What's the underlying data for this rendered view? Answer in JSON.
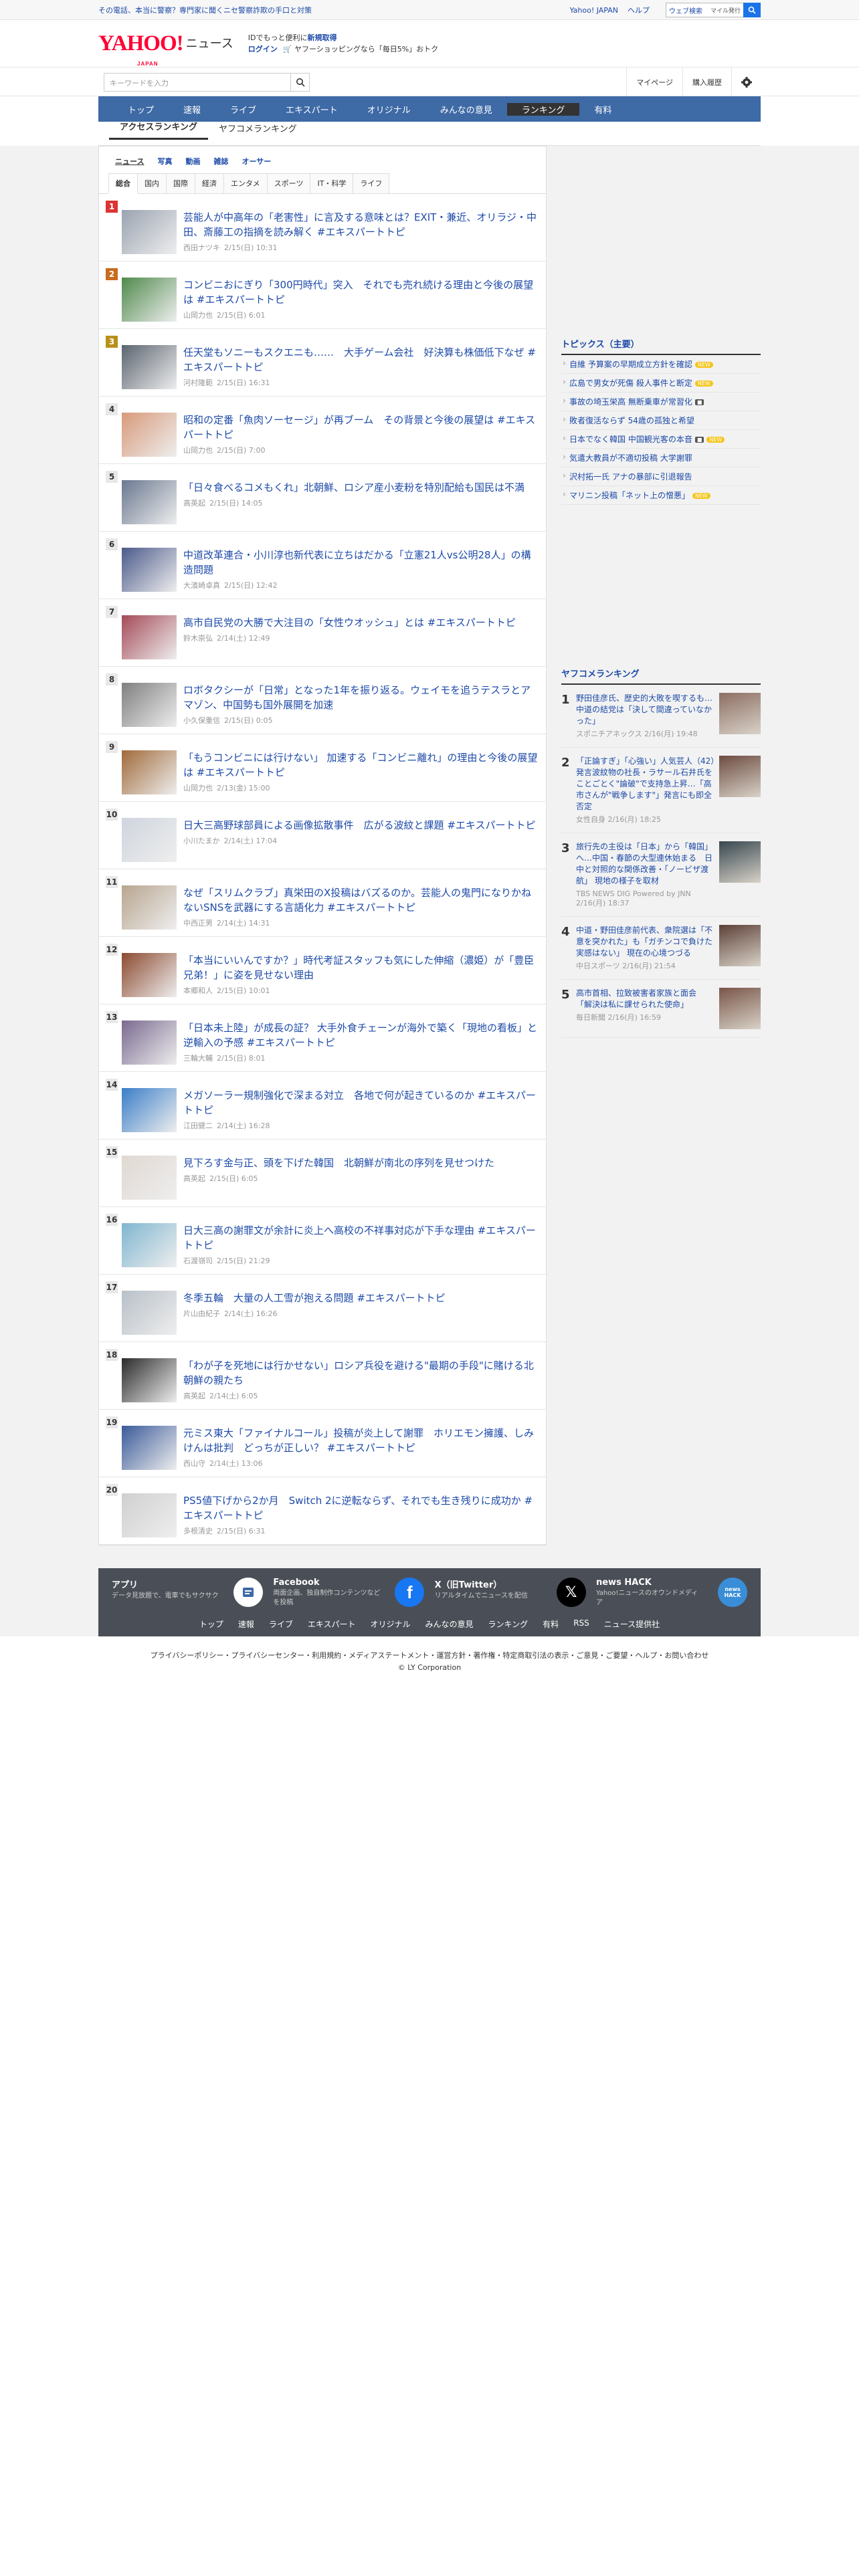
{
  "topbar": {
    "promo": "その電話、本当に警察？専門家に聞くニセ警察詐欺の手口と対策",
    "links": [
      "Yahoo! JAPAN",
      "ヘルプ"
    ],
    "search_placeholder": "ウェブ検索",
    "mygyoko": "マイル発行"
  },
  "masthead": {
    "logo_text": "YAHOO!",
    "logo_sub": "JAPAN",
    "section": "ニュース",
    "line1_pre": "IDでもっと便利に",
    "line1_link": "新規取得",
    "line2_login": "ログイン",
    "line2_text": "ヤフーショッピングなら「毎日5%」おトク"
  },
  "searchrow": {
    "placeholder": "キーワードを入力",
    "mypage": "マイページ",
    "history": "購入履歴"
  },
  "gnav": [
    "トップ",
    "速報",
    "ライブ",
    "エキスパート",
    "オリジナル",
    "みんなの意見",
    "ランキング",
    "有料"
  ],
  "subnav": [
    "アクセスランキング",
    "ヤフコメランキング"
  ],
  "cat1": [
    "ニュース",
    "写真",
    "動画",
    "雑誌",
    "オーサー"
  ],
  "cat2": [
    "総合",
    "国内",
    "国際",
    "経済",
    "エンタメ",
    "スポーツ",
    "IT・科学",
    "ライフ"
  ],
  "ranking": [
    {
      "n": "1",
      "title": "芸能人が中高年の「老害性」に言及する意味とは？EXIT・兼近、オリラジ・中田、斎藤工の指摘を読み解く #エキスパートトピ",
      "src": "西田ナツキ",
      "date": "2/15(日) 10:31"
    },
    {
      "n": "2",
      "title": "コンビニおにぎり「300円時代」突入　それでも売れ続ける理由と今後の展望は #エキスパートトピ",
      "src": "山岡力也",
      "date": "2/15(日) 6:01"
    },
    {
      "n": "3",
      "title": "任天堂もソニーもスクエニも……　大手ゲーム会社　好決算も株価低下なぜ #エキスパートトピ",
      "src": "河村隆範",
      "date": "2/15(日) 16:31"
    },
    {
      "n": "4",
      "title": "昭和の定番「魚肉ソーセージ」が再ブーム　その背景と今後の展望は #エキスパートトピ",
      "src": "山岡力也",
      "date": "2/15(日) 7:00"
    },
    {
      "n": "5",
      "title": "「日々食べるコメもくれ」北朝鮮、ロシア産小麦粉を特別配給も国民は不満",
      "src": "高英起",
      "date": "2/15(日) 14:05"
    },
    {
      "n": "6",
      "title": "中道改革連合・小川淳也新代表に立ちはだかる「立憲21人vs公明28人」の構造問題",
      "src": "大濱崎卓真",
      "date": "2/15(日) 12:42"
    },
    {
      "n": "7",
      "title": "高市自民党の大勝で大注目の「女性ウオッシュ」とは #エキスパートトピ",
      "src": "鈴木崇弘",
      "date": "2/14(土) 12:49"
    },
    {
      "n": "8",
      "title": "ロボタクシーが「日常」となった1年を振り返る。ウェイモを追うテスラとアマゾン、中国勢も国外展開を加速",
      "src": "小久保重信",
      "date": "2/15(日) 0:05"
    },
    {
      "n": "9",
      "title": "「もうコンビニには行けない」 加速する「コンビニ離れ」の理由と今後の展望は #エキスパートトピ",
      "src": "山岡力也",
      "date": "2/13(金) 15:00"
    },
    {
      "n": "10",
      "title": "日大三高野球部員による画像拡散事件　広がる波紋と課題 #エキスパートトピ",
      "src": "小川たまか",
      "date": "2/14(土) 17:04"
    },
    {
      "n": "11",
      "title": "なぜ「スリムクラブ」真栄田のX投稿はバズるのか。芸能人の鬼門になりかねないSNSを武器にする言語化力 #エキスパートトピ",
      "src": "中西正男",
      "date": "2/14(土) 14:31"
    },
    {
      "n": "12",
      "title": "「本当にいいんですか？」時代考証スタッフも気にした伸縮（濃姫）が「豊臣兄弟！」に姿を見せない理由",
      "src": "本郷和人",
      "date": "2/15(日) 10:01"
    },
    {
      "n": "13",
      "title": "「日本未上陸」が成長の証？ 大手外食チェーンが海外で築く「現地の看板」と逆輸入の予感 #エキスパートトピ",
      "src": "三輪大輔",
      "date": "2/15(日) 8:01"
    },
    {
      "n": "14",
      "title": "メガソーラー規制強化で深まる対立　各地で何が起きているのか #エキスパートトピ",
      "src": "江田健二",
      "date": "2/14(土) 16:28"
    },
    {
      "n": "15",
      "title": "見下ろす金与正、頭を下げた韓国　北朝鮮が南北の序列を見せつけた",
      "src": "高英起",
      "date": "2/15(日) 6:05"
    },
    {
      "n": "16",
      "title": "日大三高の謝罪文が余計に炎上へ高校の不祥事対応が下手な理由 #エキスパートトピ",
      "src": "石渡嶺司",
      "date": "2/15(日) 21:29"
    },
    {
      "n": "17",
      "title": "冬季五輪　大量の人工雪が抱える問題 #エキスパートトピ",
      "src": "片山由紀子",
      "date": "2/14(土) 16:26"
    },
    {
      "n": "18",
      "title": "「わが子を死地には行かせない」ロシア兵役を避ける\"最期の手段\"に賭ける北朝鮮の親たち",
      "src": "高英起",
      "date": "2/14(土) 6:05"
    },
    {
      "n": "19",
      "title": "元ミス東大「ファイナルコール」投稿が炎上して謝罪　ホリエモン擁護、しみけんは批判　どっちが正しい？ #エキスパートトピ",
      "src": "西山守",
      "date": "2/14(土) 13:06"
    },
    {
      "n": "20",
      "title": "PS5値下げから2か月　Switch 2に逆転ならず、それでも生き残りに成功か #エキスパートトピ",
      "src": "多根清史",
      "date": "2/15(日) 6:31"
    }
  ],
  "topics": {
    "title": "トピックス（主要）",
    "items": [
      {
        "t": "自維 予算案の早期成立方針を確認",
        "b": "NEW"
      },
      {
        "t": "広島で男女が死傷 殺人事件と断定",
        "b": "NEW"
      },
      {
        "t": "事故の埼玉栄高 無断乗車が常習化",
        "b": "cam"
      },
      {
        "t": "敗者復活ならず 54歳の孤独と希望",
        "b": ""
      },
      {
        "t": "日本でなく韓国 中国観光客の本音",
        "b": "both"
      },
      {
        "t": "気遣大教員が不適切投稿 大学謝罪",
        "b": ""
      },
      {
        "t": "沢村拓一氏 アナの暴部に引退報告",
        "b": ""
      },
      {
        "t": "マリニン投稿「ネット上の憎悪」",
        "b": "NEW"
      }
    ]
  },
  "yafoo": {
    "title": "ヤフコメランキング",
    "items": [
      {
        "n": "1",
        "t": "野田佳彦氏、歴史的大敗を喫するも…中道の結党は「決して間違っていなかった」",
        "m": "スポニチアネックス 2/16(月) 19:48"
      },
      {
        "n": "2",
        "t": "「正論すぎ」「心強い」人気芸人（42）　発言波紋物の社長・ラサール石井氏をことごとく\"論破\"で支持急上昇…「高市さんが\"戦争します\"」発言にも即全否定",
        "m": "女性自身 2/16(月) 18:25"
      },
      {
        "n": "3",
        "t": "旅行先の主役は「日本」から「韓国」へ…中国・春節の大型連休始まる　日中と対照的な関係改善・「ノービザ渡航」 現地の様子を取材",
        "m": "TBS NEWS DIG Powered by JNN 2/16(月) 18:37"
      },
      {
        "n": "4",
        "t": "中道・野田佳彦前代表、衆院選は「不意を突かれた」も「ガチンコで負けた実感はない」 現在の心境つづる",
        "m": "中日スポーツ 2/16(月) 21:54"
      },
      {
        "n": "5",
        "t": "高市首相、拉致被害者家族と面会　「解決は私に課せられた使命」",
        "m": "毎日新聞 2/16(月) 16:59"
      }
    ]
  },
  "footer": {
    "apps": [
      {
        "t": "アプリ",
        "d": "データ見放題で、電車でもサクサク",
        "icon": "app-icon"
      },
      {
        "t": "Facebook",
        "d": "両面企画、独自制作コンテンツなどを投稿",
        "icon": "facebook-icon"
      },
      {
        "t": "X（旧Twitter）",
        "d": "リアルタイムでニュースを配信",
        "icon": "x-icon"
      },
      {
        "t": "news HACK",
        "d": "Yahoo!ニュースのオウンドメディア",
        "icon": "newshack-icon"
      }
    ],
    "links": [
      "トップ",
      "速報",
      "ライブ",
      "エキスパート",
      "オリジナル",
      "みんなの意見",
      "ランキング",
      "有料",
      "RSS",
      "ニュース提供社"
    ],
    "legal": "プライバシーポリシー・プライバシーセンター・利用規約・メディアステートメント・運営方針・著作権・特定商取引法の表示・ご意見・ご要望・ヘルプ・お問い合わせ",
    "copyright": "© LY Corporation",
    "newshack_icon_text": "news HACK"
  }
}
